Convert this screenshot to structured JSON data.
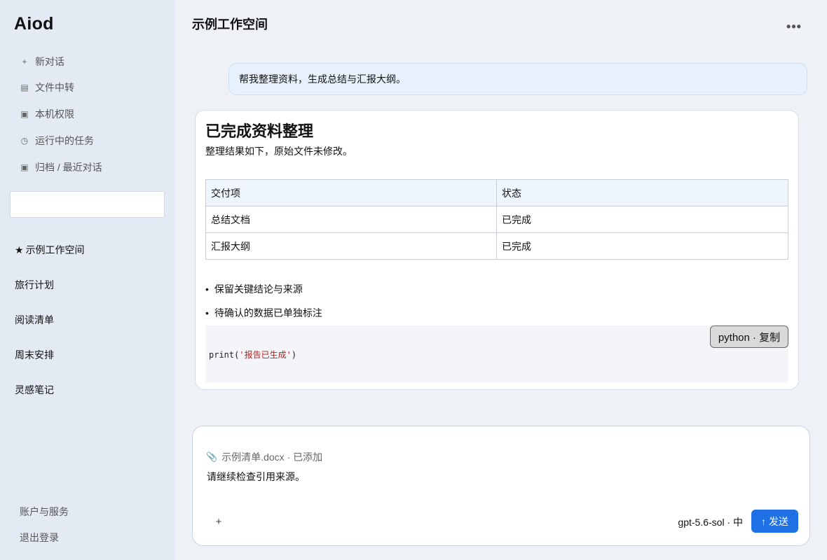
{
  "sidebar": {
    "brand": "Aiod",
    "nav": [
      {
        "icon": "+",
        "icon_name": "plus-icon",
        "label": "新对话"
      },
      {
        "icon": "▤",
        "icon_name": "file-icon",
        "label": "文件中转"
      },
      {
        "icon": "▣",
        "icon_name": "permission-icon",
        "label": "本机权限"
      },
      {
        "icon": "◷",
        "icon_name": "clock-icon",
        "label": "运行中的任务"
      },
      {
        "icon": "▣",
        "icon_name": "archive-icon",
        "label": "归档 / 最近对话"
      }
    ],
    "search": {
      "value": "",
      "placeholder": ""
    },
    "workspaces": [
      {
        "star": "★",
        "label": "示例工作空间"
      },
      {
        "label": "旅行计划"
      },
      {
        "label": "阅读清单"
      },
      {
        "label": "周末安排"
      },
      {
        "label": "灵感笔记"
      }
    ],
    "footer": [
      {
        "label": "账户与服务"
      },
      {
        "label": "退出登录"
      }
    ]
  },
  "header": {
    "title": "示例工作空间",
    "more_label": "•••"
  },
  "conversation": {
    "user_message": "帮我整理资料，生成总结与汇报大纲。",
    "reply": {
      "title": "已完成资料整理",
      "subtitle": "整理结果如下，原始文件未修改。",
      "table": {
        "headers": [
          "交付项",
          "状态"
        ],
        "rows": [
          [
            "总结文档",
            "已完成"
          ],
          [
            "汇报大纲",
            "已完成"
          ]
        ]
      },
      "bullets": [
        "保留关键结论与来源",
        "待确认的数据已单独标注"
      ],
      "code": {
        "prefix": "print(",
        "string": "'报告已生成'",
        "suffix": ")",
        "copy_label": "python · 复制"
      }
    }
  },
  "composer": {
    "attachment_icon": "📎",
    "attachment": "示例清单.docx · 已添加",
    "input_value": "请继续检查引用来源。",
    "add_label": "+",
    "model": "gpt-5.6-sol · 中",
    "send_label": "↑ 发送",
    "send_color": "#1f6fe5"
  }
}
